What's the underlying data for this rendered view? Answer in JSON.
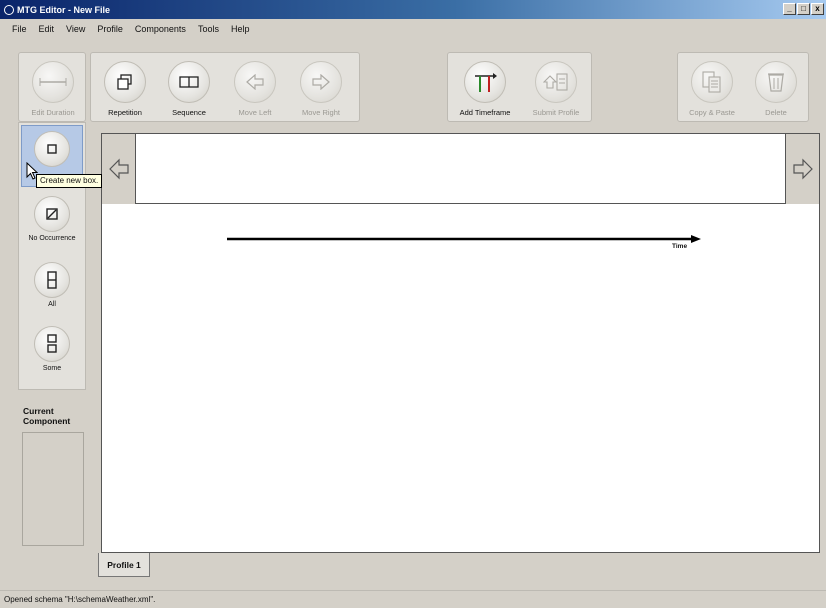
{
  "window": {
    "title": "MTG Editor - New File"
  },
  "titlebar_buttons": {
    "minimize": "_",
    "maximize": "□",
    "close": "x"
  },
  "menu": [
    "File",
    "Edit",
    "View",
    "Profile",
    "Components",
    "Tools",
    "Help"
  ],
  "toolbar": {
    "edit_duration": "Edit Duration",
    "repetition": "Repetition",
    "sequence": "Sequence",
    "move_left": "Move Left",
    "move_right": "Move Right",
    "add_timeframe": "Add Timeframe",
    "submit_profile": "Submit Profile",
    "copy_paste": "Copy & Paste",
    "delete": "Delete"
  },
  "left_panel": {
    "create_box_tooltip": "Create new box.",
    "no_occurrence": "No Occurrence",
    "all": "All",
    "some": "Some"
  },
  "current_component": {
    "title": "Current Component"
  },
  "canvas": {
    "time_label": "Time"
  },
  "tabs": [
    "Profile 1"
  ],
  "status": "Opened schema \"H:\\schemaWeather.xml\".",
  "colors": {
    "title_gradient_start": "#0a246a",
    "add_timeframe_green": "#2a8a2a",
    "add_timeframe_red": "#c02020"
  }
}
